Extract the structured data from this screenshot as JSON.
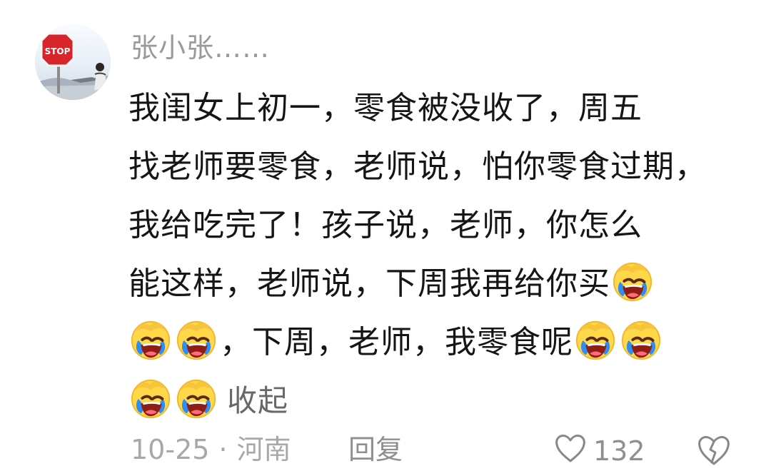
{
  "comment": {
    "author": {
      "name": "张小张……",
      "avatar_icon": "stop-sign-avatar"
    },
    "text_lines": [
      "我闺女上初一，零食被没收了，周五",
      "找老师要零食，老师说，怕你零食过期，",
      "我给吃完了！孩子说，老师，你怎么",
      "能这样，老师说，下周我再给你买",
      "，下周，老师，我零食呢"
    ],
    "emoji_name": "laughing-crying-face",
    "collapse_label": "收起",
    "date": "10-25",
    "separator": "·",
    "location": "河南",
    "reply_label": "回复",
    "like_count": "132"
  },
  "colors": {
    "text": "#151515",
    "secondary_text": "#9a9a9a",
    "link_text": "#686868",
    "emoji_yellow": "#ffd84a",
    "emoji_blue": "#2f8ef0"
  }
}
